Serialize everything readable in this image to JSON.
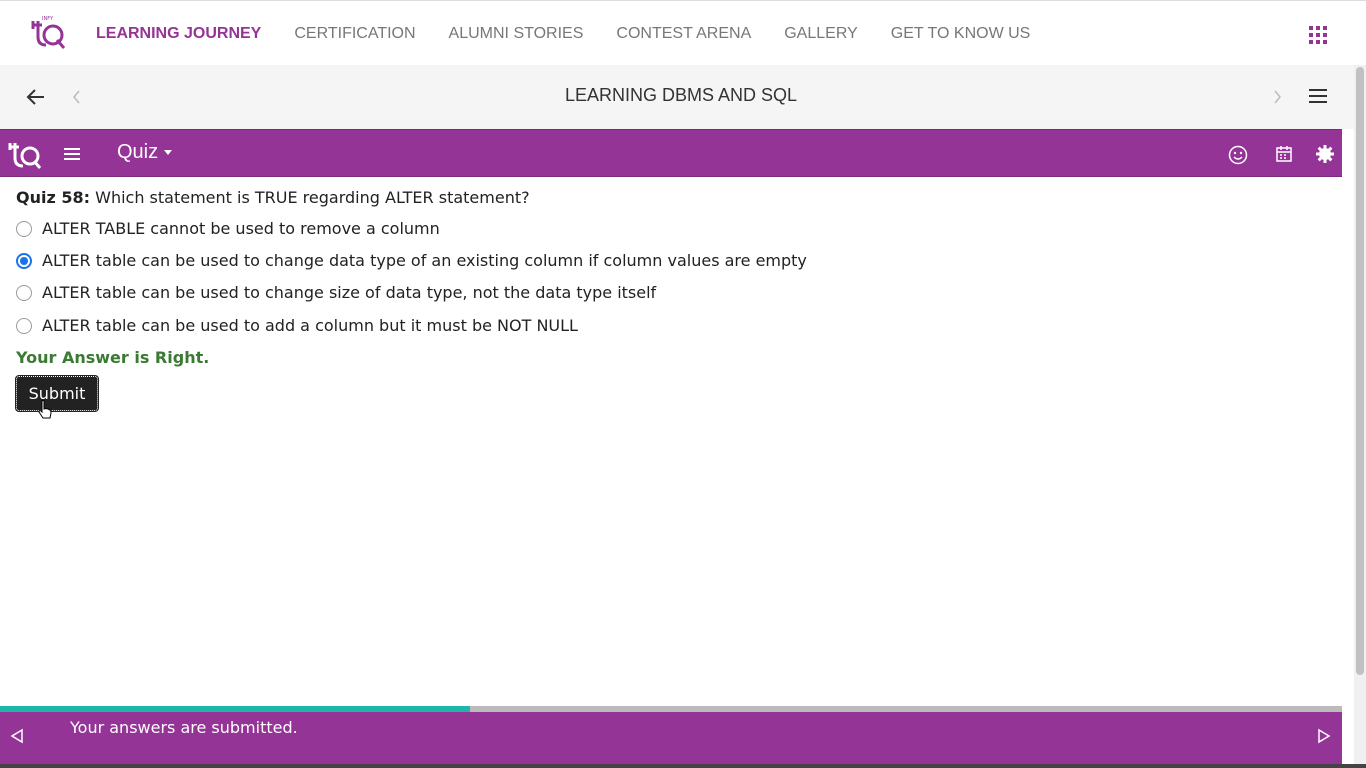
{
  "nav": {
    "items": [
      {
        "label": "LEARNING JOURNEY",
        "active": true
      },
      {
        "label": "CERTIFICATION",
        "active": false
      },
      {
        "label": "ALUMNI STORIES",
        "active": false
      },
      {
        "label": "CONTEST ARENA",
        "active": false
      },
      {
        "label": "GALLERY",
        "active": false
      },
      {
        "label": "GET TO KNOW US",
        "active": false
      }
    ],
    "apps_icon": "grid-apps-icon"
  },
  "course": {
    "title": "LEARNING DBMS AND SQL"
  },
  "toolbar": {
    "dropdown_label": "Quiz",
    "icons": [
      "smiley-icon",
      "calendar-icon",
      "gear-icon"
    ]
  },
  "quiz": {
    "number_label": "Quiz 58:",
    "question": "Which statement is TRUE regarding ALTER statement?",
    "options": [
      {
        "label": "ALTER TABLE cannot be used to remove a column",
        "selected": false
      },
      {
        "label": "ALTER table can be used to change data type of an existing column if column values are empty",
        "selected": true
      },
      {
        "label": "ALTER table can be used to change size of data type, not the data type itself",
        "selected": false
      },
      {
        "label": "ALTER table can be used to add a column but it must be NOT NULL",
        "selected": false
      }
    ],
    "result": "Your Answer is Right.",
    "submit_label": "Submit"
  },
  "footer": {
    "message": "Your answers are submitted.",
    "progress_fraction": 0.35
  },
  "colors": {
    "brand": "#953497",
    "progress": "#1fb5ad",
    "success": "#3b7a33",
    "radio": "#1a73e8"
  }
}
